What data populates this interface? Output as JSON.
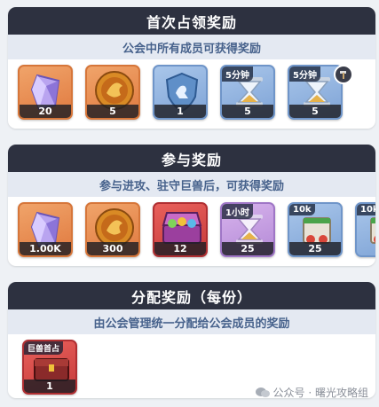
{
  "sections": [
    {
      "title": "首次占领奖励",
      "subtitle": "公会中所有成员可获得奖励",
      "items": [
        {
          "icon": "crystal-icon",
          "count": "20"
        },
        {
          "icon": "gold-coin-icon",
          "count": "5"
        },
        {
          "icon": "shield-token-icon",
          "count": "1"
        },
        {
          "icon": "hourglass-icon",
          "tag": "5分钟",
          "count": "5"
        },
        {
          "icon": "hourglass-icon",
          "tag": "5分钟",
          "count": "5",
          "badge": "hammer-icon"
        }
      ]
    },
    {
      "title": "参与奖励",
      "subtitle": "参与进攻、驻守巨兽后，可获得奖励",
      "items": [
        {
          "icon": "crystal-icon",
          "count": "1.00K"
        },
        {
          "icon": "gold-coin-icon",
          "count": "300"
        },
        {
          "icon": "treasure-chest-icon",
          "count": "12"
        },
        {
          "icon": "hourglass-icon",
          "tag": "1小时",
          "count": "25"
        },
        {
          "icon": "food-bag-icon",
          "tag": "10k",
          "count": "25"
        },
        {
          "icon": "food-bag-icon",
          "tag": "10k",
          "count": ""
        }
      ]
    },
    {
      "title": "分配奖励（每份）",
      "subtitle": "由公会管理统一分配给公会成员的奖励",
      "items": [
        {
          "icon": "beast-chest-icon",
          "tag": "巨兽首占",
          "count": "1"
        }
      ]
    }
  ],
  "watermark": "公众号 · 曙光攻略组"
}
